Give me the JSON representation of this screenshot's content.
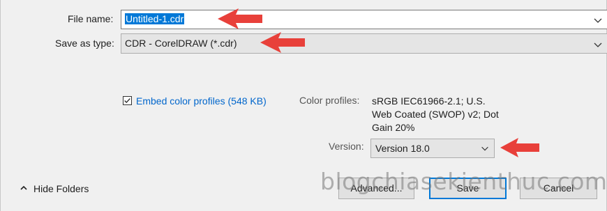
{
  "file_name": {
    "label": "File name:",
    "value": "Untitled-1.cdr"
  },
  "save_as_type": {
    "label": "Save as type:",
    "value": "CDR - CorelDRAW (*.cdr)"
  },
  "embed_color_profiles": {
    "checked": true,
    "label": "Embed color profiles (548 KB)"
  },
  "color_profiles": {
    "label": "Color profiles:",
    "value": "sRGB IEC61966-2.1; U.S. Web Coated (SWOP) v2; Dot Gain 20%"
  },
  "version": {
    "label": "Version:",
    "value": "Version 18.0"
  },
  "hide_folders": {
    "label": "Hide Folders"
  },
  "buttons": {
    "advanced": "Advanced...",
    "save": "Save",
    "cancel": "Cancel"
  },
  "watermark": "blogchiasekienthuc.com",
  "colors": {
    "accent": "#0078d7",
    "link": "#0066cc",
    "annotation_arrow": "#e8403a"
  },
  "icons": {
    "dropdown": "chevron-down-icon",
    "hide_folders": "caret-up-icon",
    "checkbox": "checkmark-icon",
    "annotation": "red-arrow-icon"
  }
}
